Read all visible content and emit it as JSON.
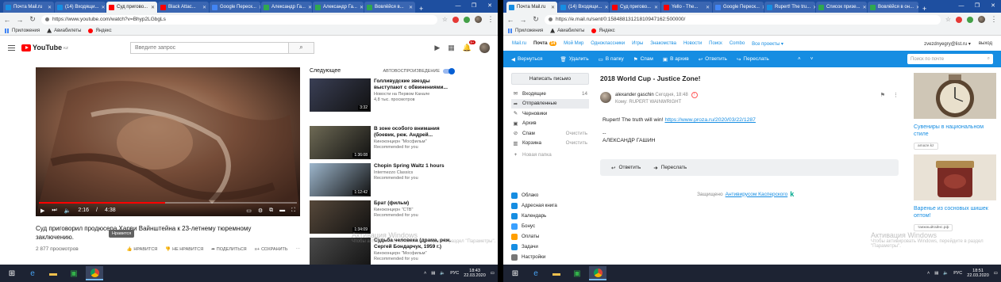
{
  "left": {
    "tabs": [
      {
        "label": "Почта Mail.ru",
        "color": "#168de2",
        "active": false
      },
      {
        "label": "(14) Входящи...",
        "color": "#168de2",
        "active": false
      },
      {
        "label": "Суд пригово...",
        "color": "#ff0000",
        "active": true
      },
      {
        "label": "Black Attac...",
        "color": "#ff0000",
        "active": false
      },
      {
        "label": "Google Переск...",
        "color": "#4285f4",
        "active": false
      },
      {
        "label": "Александр Га...",
        "color": "#2fa84f",
        "active": false
      },
      {
        "label": "Александр Га...",
        "color": "#2fa84f",
        "active": false
      },
      {
        "label": "Вовлёйся в...",
        "color": "#2fa84f",
        "active": false
      }
    ],
    "url": "https://www.youtube.com/watch?v=Bhyp2LGbgLs",
    "bookmarks": [
      "Приложения",
      "Авиабилеты",
      "Яндекс"
    ],
    "youtube": {
      "logo_text": "YouTube",
      "logo_region": "KZ",
      "search_placeholder": "Введите запрос",
      "notif_count": "9+",
      "time_current": "2:16",
      "time_total": "4:38",
      "progress": 0.49,
      "video_title": "Суд приговорил продюсера Харви Вайнштейна к 23-летнему тюремному заключению.",
      "views": "2 877 просмотров",
      "tooltip": "Нравится",
      "actions": {
        "like": "НРАВИТСЯ",
        "dislike": "НЕ НРАВИТСЯ",
        "share": "ПОДЕЛИТЬСЯ",
        "save": "СОХРАНИТЬ"
      },
      "upnext_label": "Следующее",
      "autoplay_label": "АВТОВОСПРОИЗВЕДЕНИЕ",
      "recommended": [
        {
          "title": "Голливудские звезды выступают с обвинениями...",
          "channel": "Новости на Первом Канале",
          "meta": "4,8 тыс. просмотров",
          "duration": "3:32",
          "thumb": "#3a3f55"
        },
        {
          "title": "В зоне особого внимания (боевик, реж. Андрей...",
          "channel": "Киноконцерн \"Мосфильм\"",
          "meta": "Recommended for you",
          "duration": "1:36:08",
          "thumb": "#6e6a55"
        },
        {
          "title": "Chopin Spring Waltz 1 hours",
          "channel": "Intermezzo Classics",
          "meta": "Recommended for you",
          "duration": "1:12:42",
          "thumb": "#9db6cc"
        },
        {
          "title": "Брат (фильм)",
          "channel": "Киноконцерн \"СТВ\"",
          "meta": "Recommended for you",
          "duration": "1:34:09",
          "thumb": "#56483a"
        },
        {
          "title": "Судьба человека (драма, реж. Сергей Бондарчук, 1959 г.)",
          "channel": "Киноконцерн \"Мосфильм\"",
          "meta": "Recommended for you",
          "duration": "",
          "thumb": "#4a4a4a"
        }
      ]
    },
    "activation": {
      "line1": "Активация Windows",
      "line2": "Чтобы активировать Windows, перейдите в раздел \"Параметры\"."
    },
    "tray": {
      "lang": "РУС",
      "time": "18:43",
      "date": "22.03.2020"
    }
  },
  "right": {
    "tabs": [
      {
        "label": "Почта Mail.ru",
        "color": "#168de2",
        "active": true
      },
      {
        "label": "(14) Входящи...",
        "color": "#168de2",
        "active": false
      },
      {
        "label": "Суд пригово...",
        "color": "#ff0000",
        "active": false
      },
      {
        "label": "Yello - The...",
        "color": "#ff0000",
        "active": false
      },
      {
        "label": "Google Переск...",
        "color": "#4285f4",
        "active": false
      },
      {
        "label": "Rupert! The tru...",
        "color": "#168de2",
        "active": false
      },
      {
        "label": "Список призе...",
        "color": "#2fa84f",
        "active": false
      },
      {
        "label": "Вовлёйся в он...",
        "color": "#2fa84f",
        "active": false
      }
    ],
    "url": "https://e.mail.ru/sent/0:15848813121810947162:500000/",
    "bookmarks": [
      "Приложения",
      "Авиабилеты",
      "Яндекс"
    ],
    "portal_links": [
      "Mail.ru",
      "Почта",
      "Мой Мир",
      "Одноклассники",
      "Игры",
      "Знакомства",
      "Новости",
      "Поиск",
      "Combo",
      "Все проекты ▾"
    ],
    "mail_badge": "14",
    "user_email": "zvezdnyegry@list.ru ▾",
    "logout": "выход",
    "toolbar": {
      "back": "Вернуться",
      "delete": "Удалить",
      "to_folder": "В папку",
      "spam": "Спам",
      "archive": "В архив",
      "reply": "Ответить",
      "forward": "Переслать",
      "search": "Поиск по почте"
    },
    "compose": "Написать письмо",
    "folders": [
      {
        "name": "Входящие",
        "count": "14",
        "icon": "✉"
      },
      {
        "name": "Отправленные",
        "count": "",
        "icon": "➦"
      },
      {
        "name": "Черновики",
        "count": "",
        "icon": "✎"
      },
      {
        "name": "Архив",
        "count": "",
        "icon": "▣"
      },
      {
        "name": "Спам",
        "count": "Очистить",
        "icon": "⊘"
      },
      {
        "name": "Корзина",
        "count": "Очистить",
        "icon": "▥"
      }
    ],
    "new_folder": "Новая папка",
    "apps": [
      {
        "name": "Облако",
        "color": "#168de2"
      },
      {
        "name": "Адресная книга",
        "color": "#168de2"
      },
      {
        "name": "Календарь",
        "color": "#168de2"
      },
      {
        "name": "Бонус",
        "color": "#3aa0ff"
      },
      {
        "name": "Оплаты",
        "color": "#ff9e00"
      },
      {
        "name": "Задачи",
        "color": "#168de2"
      },
      {
        "name": "Настройки",
        "color": "#777777"
      }
    ],
    "letter": {
      "subject": "2018 World Cup - Justice Zone!",
      "sender": "alexander gaschin",
      "date": "Сегодня, 18:48",
      "to": "Кому: RUPERT WAINWRIGHT",
      "body_text": "Rupert! The truth will win!",
      "link": "https://www.proza.ru/2020/03/22/1287",
      "sig_sep": "--",
      "signature": "АЛЕКСАНДР ГАШИН"
    },
    "reply_bar": {
      "reply": "Ответить",
      "forward": "Переслать"
    },
    "virus_text": "Защищено",
    "virus_link": "Антивирусом Касперского",
    "ads": [
      {
        "title": "Сувениры в национальном стиле",
        "source": "amaze.kz",
        "img": "#8a7660"
      },
      {
        "title": "Варенье из сосновых шишек оптом!",
        "source": "таежныйгайнс.рф",
        "img": "#7a2a24"
      }
    ],
    "activation": {
      "line1": "Активация Windows",
      "line2": "Чтобы активировать Windows, перейдите в раздел \"Параметры\"."
    },
    "tray": {
      "lang": "РУС",
      "time": "18:51",
      "date": "22.03.2020"
    }
  }
}
